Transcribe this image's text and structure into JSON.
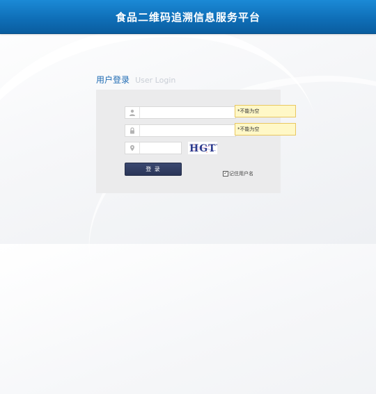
{
  "header": {
    "title": "食品二维码追溯信息服务平台"
  },
  "login": {
    "heading_cn": "用户登录",
    "heading_en": "User Login",
    "username": {
      "value": "",
      "placeholder": "",
      "icon": "user-icon",
      "tip": "*不能为空"
    },
    "password": {
      "value": "",
      "placeholder": "",
      "icon": "lock-icon",
      "tip": "*不能为空"
    },
    "captcha": {
      "value": "",
      "placeholder": "",
      "icon": "location-pin-icon",
      "text": "HGTY"
    },
    "login_button": "登 录",
    "remember": {
      "label": "记住用户名",
      "checked": true
    }
  },
  "colors": {
    "header": "#0f6fb8",
    "heading": "#1e6bb3",
    "button": "#2f3b60",
    "tip_bg": "#fff8c7",
    "tip_border": "#e9c760"
  }
}
